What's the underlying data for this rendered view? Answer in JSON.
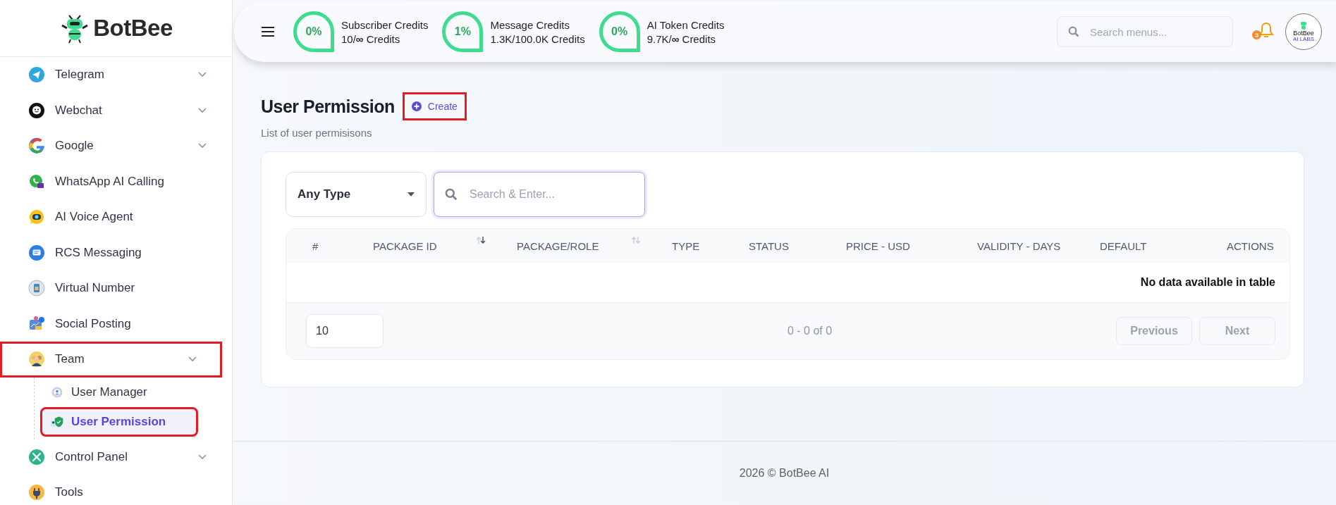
{
  "brand": {
    "name": "BotBee"
  },
  "sidebar": {
    "items": [
      {
        "label": "Telegram",
        "expandable": true,
        "selected": false,
        "annotated": false
      },
      {
        "label": "Webchat",
        "expandable": true,
        "selected": false,
        "annotated": false
      },
      {
        "label": "Google",
        "expandable": true,
        "selected": false,
        "annotated": false
      },
      {
        "label": "WhatsApp AI Calling",
        "expandable": false,
        "selected": false,
        "annotated": false
      },
      {
        "label": "AI Voice Agent",
        "expandable": false,
        "selected": false,
        "annotated": false
      },
      {
        "label": "RCS Messaging",
        "expandable": false,
        "selected": false,
        "annotated": false
      },
      {
        "label": "Virtual Number",
        "expandable": false,
        "selected": false,
        "annotated": false
      },
      {
        "label": "Social Posting",
        "expandable": false,
        "selected": false,
        "annotated": false
      },
      {
        "label": "Team",
        "expandable": true,
        "selected": false,
        "annotated": true,
        "children": [
          {
            "label": "User Manager",
            "selected": false,
            "annotated": false
          },
          {
            "label": "User Permission",
            "selected": true,
            "annotated": true
          }
        ]
      },
      {
        "label": "Control Panel",
        "expandable": true,
        "selected": false,
        "annotated": false
      },
      {
        "label": "Tools",
        "expandable": false,
        "selected": false,
        "annotated": false
      }
    ]
  },
  "credits": [
    {
      "percent": "0%",
      "label": "Subscriber Credits",
      "amount": "10/**∞** Credits"
    },
    {
      "percent": "1%",
      "label": "Message Credits",
      "amount": "1.3K/100.0K Credits"
    },
    {
      "percent": "0%",
      "label": "AI Token Credits",
      "amount": "9.7K/**∞** Credits"
    }
  ],
  "search": {
    "placeholder": "Search menus..."
  },
  "notifications": {
    "count": "3"
  },
  "avatar": {
    "logo_text": "BotBee",
    "logo_subtext": "AI LABS"
  },
  "page": {
    "title": "User Permission",
    "create_button": {
      "label": "Create",
      "annotated": true
    },
    "subtitle": "List of user permisisons"
  },
  "filters": {
    "type_select": "Any Type",
    "search_placeholder": "Search & Enter..."
  },
  "table": {
    "columns": [
      {
        "label": "#"
      },
      {
        "label": "PACKAGE ID",
        "sortable": true,
        "sort_active": true
      },
      {
        "label": "PACKAGE/ROLE",
        "sortable": true,
        "sort_active": false
      },
      {
        "label": "TYPE"
      },
      {
        "label": "STATUS"
      },
      {
        "label": "PRICE - USD"
      },
      {
        "label": "VALIDITY - DAYS"
      },
      {
        "label": "DEFAULT"
      },
      {
        "label": "ACTIONS"
      }
    ],
    "empty_message": "No data available in table",
    "page_size": "10",
    "info": "0 - 0 of 0",
    "buttons": [
      {
        "label": "Previous",
        "disabled": true
      },
      {
        "label": "Next",
        "disabled": true
      }
    ]
  },
  "footer": {
    "text": "2026 © BotBee AI"
  }
}
